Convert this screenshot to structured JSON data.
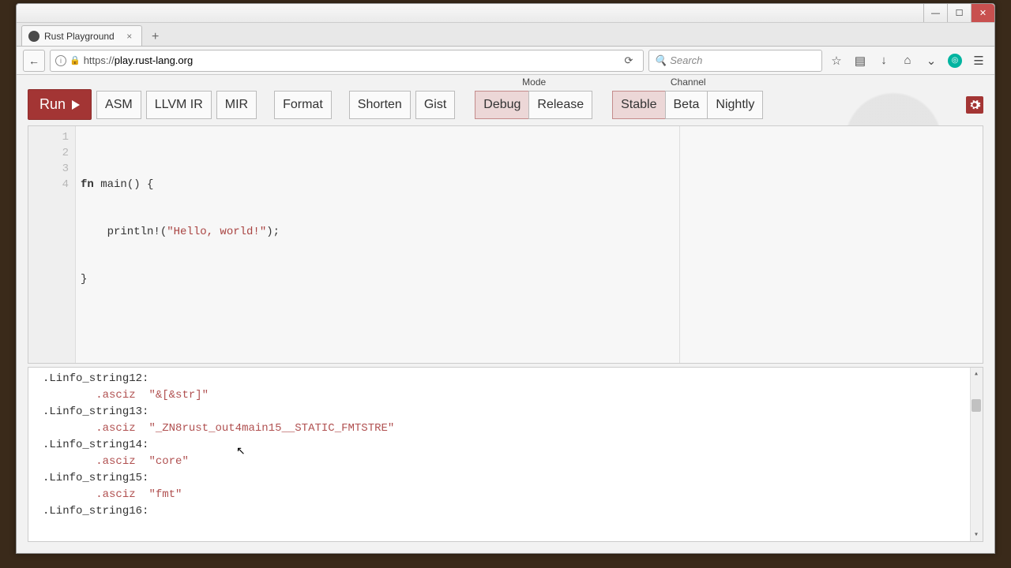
{
  "window": {
    "title": "Rust Playground"
  },
  "tab": {
    "title": "Rust Playground"
  },
  "url": {
    "scheme": "https://",
    "host": "play.rust-lang.org",
    "path": ""
  },
  "search": {
    "placeholder": "Search"
  },
  "toolbar": {
    "run": "Run",
    "asm": "ASM",
    "llvm": "LLVM IR",
    "mir": "MIR",
    "format": "Format",
    "shorten": "Shorten",
    "gist": "Gist",
    "mode_label": "Mode",
    "mode": {
      "debug": "Debug",
      "release": "Release",
      "active": "debug"
    },
    "channel_label": "Channel",
    "channel": {
      "stable": "Stable",
      "beta": "Beta",
      "nightly": "Nightly",
      "active": "stable"
    }
  },
  "editor": {
    "lines": [
      "1",
      "2",
      "3",
      "4"
    ],
    "code": {
      "l1_a": "fn",
      "l1_b": " main() {",
      "l2_a": "    println!(",
      "l2_b": "\"Hello, world!\"",
      "l2_c": ");",
      "l3": "}",
      "l4": ""
    }
  },
  "output": {
    "lines": [
      {
        "t": "lbl",
        "v": ".Linfo_string12:"
      },
      {
        "t": "ins",
        "v": "        .asciz  \"&[&str]\""
      },
      {
        "t": "lbl",
        "v": ".Linfo_string13:"
      },
      {
        "t": "ins",
        "v": "        .asciz  \"_ZN8rust_out4main15__STATIC_FMTSTRE\""
      },
      {
        "t": "lbl",
        "v": ".Linfo_string14:"
      },
      {
        "t": "ins",
        "v": "        .asciz  \"core\""
      },
      {
        "t": "lbl",
        "v": ".Linfo_string15:"
      },
      {
        "t": "ins",
        "v": "        .asciz  \"fmt\""
      },
      {
        "t": "lbl",
        "v": ".Linfo_string16:"
      }
    ]
  }
}
